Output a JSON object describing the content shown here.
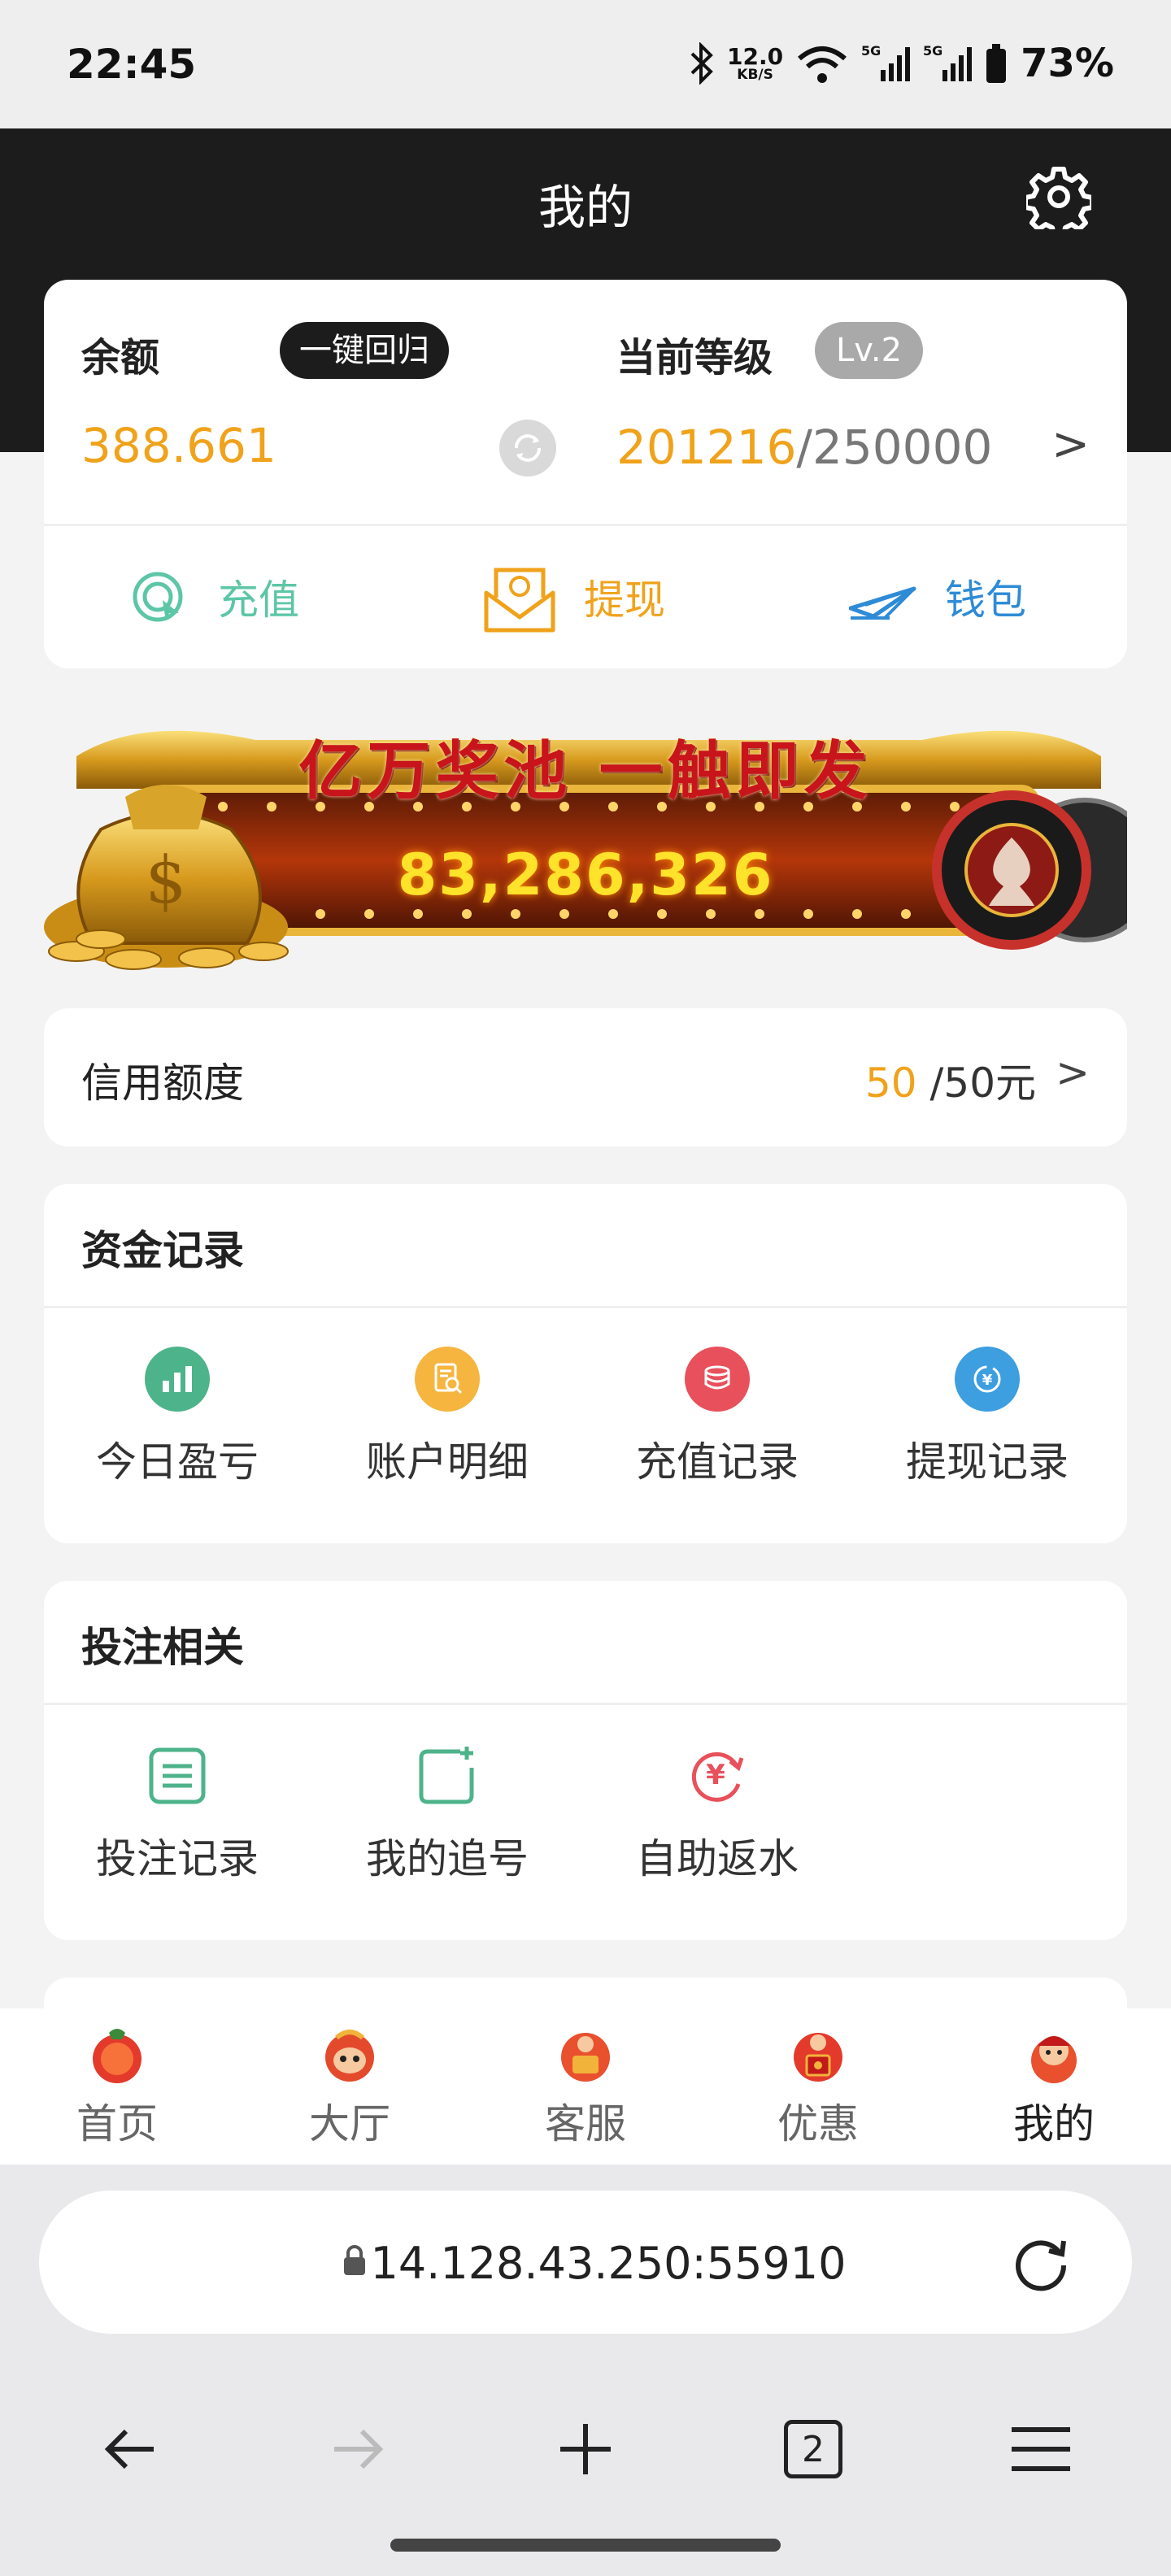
{
  "status_bar": {
    "time": "22:45",
    "net_speed": "12.0",
    "net_unit": "KB/S",
    "battery": "73%",
    "icons": [
      "bluetooth-icon",
      "wifi-icon",
      "signal-5g-icon",
      "signal-5g-icon",
      "battery-icon"
    ]
  },
  "header": {
    "title": "我的",
    "settings_icon": "gear-icon"
  },
  "balance": {
    "label": "余额",
    "recall_button": "一键回归",
    "amount": "388.661",
    "level_label": "当前等级",
    "level_badge": "Lv.2",
    "level_current": "201216",
    "level_separator": "/",
    "level_max": "250000",
    "chevron": ">"
  },
  "actions": [
    {
      "label": "充值",
      "icon": "recharge-icon",
      "color": "#5cc6a6"
    },
    {
      "label": "提现",
      "icon": "withdraw-envelope-icon",
      "color": "#f0a21a"
    },
    {
      "label": "钱包",
      "icon": "wallet-plane-icon",
      "color": "#2e8bd6"
    }
  ],
  "jackpot": {
    "title": "亿万奖池 一触即发",
    "amount": "83,286,326"
  },
  "credit": {
    "label": "信用额度",
    "current": "50",
    "max": "/50元",
    "chevron": ">"
  },
  "funds": {
    "title": "资金记录",
    "items": [
      {
        "label": "今日盈亏",
        "icon": "bar-chart-icon",
        "color": "#4db38a"
      },
      {
        "label": "账户明细",
        "icon": "document-search-icon",
        "color": "#f6b53f"
      },
      {
        "label": "充值记录",
        "icon": "coins-icon",
        "color": "#e8505b"
      },
      {
        "label": "提现记录",
        "icon": "yen-exchange-icon",
        "color": "#3d9ee0"
      }
    ]
  },
  "betting": {
    "title": "投注相关",
    "items": [
      {
        "label": "投注记录",
        "icon": "list-icon",
        "color": "#4db38a"
      },
      {
        "label": "我的追号",
        "icon": "add-square-icon",
        "color": "#4db38a"
      },
      {
        "label": "自助返水",
        "icon": "yen-refresh-icon",
        "color": "#e8505b"
      }
    ]
  },
  "bottom_nav": [
    {
      "label": "首页",
      "icon": "home-mascot-icon"
    },
    {
      "label": "大厅",
      "icon": "hall-mascot-icon"
    },
    {
      "label": "客服",
      "icon": "service-mascot-icon"
    },
    {
      "label": "优惠",
      "icon": "promo-mascot-icon"
    },
    {
      "label": "我的",
      "icon": "profile-mascot-icon",
      "active": true
    }
  ],
  "browser": {
    "url": "14.128.43.250:55910",
    "tab_count": "2"
  }
}
